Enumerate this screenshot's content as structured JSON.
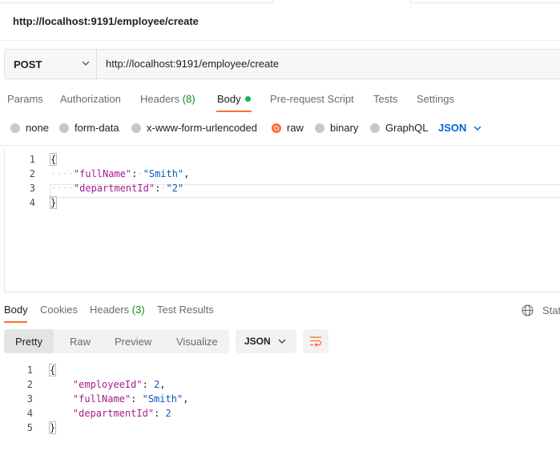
{
  "request": {
    "title_url": "http://localhost:9191/employee/create",
    "method": "POST",
    "url": "http://localhost:9191/employee/create"
  },
  "request_tabs": [
    {
      "label": "Params"
    },
    {
      "label": "Authorization"
    },
    {
      "label": "Headers",
      "count": "(8)"
    },
    {
      "label": "Body"
    },
    {
      "label": "Pre-request Script"
    },
    {
      "label": "Tests"
    },
    {
      "label": "Settings"
    }
  ],
  "body_options": {
    "none": "none",
    "form_data": "form-data",
    "urlencoded": "x-www-form-urlencoded",
    "raw": "raw",
    "binary": "binary",
    "graphql": "GraphQL",
    "format": "JSON",
    "selected": "raw"
  },
  "request_body": {
    "line_numbers": [
      "1",
      "2",
      "3",
      "4"
    ],
    "open_brace": "{",
    "key1": "\"fullName\"",
    "val1": "\"Smith\"",
    "key2": "\"departmentId\"",
    "val2": "\"2\"",
    "close_brace": "}"
  },
  "response_tabs": [
    {
      "label": "Body"
    },
    {
      "label": "Cookies"
    },
    {
      "label": "Headers",
      "count": "(3)"
    },
    {
      "label": "Test Results"
    }
  ],
  "response_status_label": "Stat",
  "response_views": {
    "pretty": "Pretty",
    "raw": "Raw",
    "preview": "Preview",
    "visualize": "Visualize",
    "format": "JSON"
  },
  "response_body": {
    "line_numbers": [
      "1",
      "2",
      "3",
      "4",
      "5"
    ],
    "open_brace": "{",
    "key1": "\"employeeId\"",
    "val1": "2",
    "key2": "\"fullName\"",
    "val2": "\"Smith\"",
    "key3": "\"departmentId\"",
    "val3": "2",
    "close_brace": "}"
  },
  "colors": {
    "accent": "#ff6c37",
    "json_blue": "#0265d2",
    "count_green": "#0e8a16",
    "status_dot": "#0cbb52"
  }
}
